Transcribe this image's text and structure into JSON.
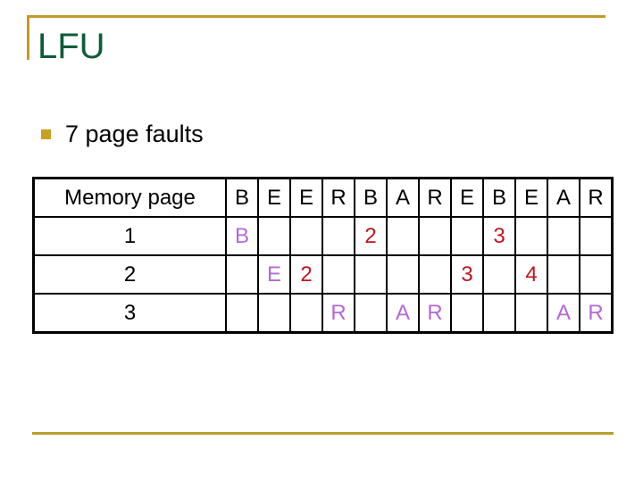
{
  "slide": {
    "title": "LFU",
    "bullets": [
      {
        "text": "7 page faults"
      }
    ]
  },
  "colors": {
    "title": "#0d5c37",
    "accent_rule": "#c09a2b",
    "bullet": "#c9a020",
    "inserted_page": "#b469d6",
    "count": "#c0141e"
  },
  "table": {
    "header_label": "Memory page",
    "reference_string": [
      "B",
      "E",
      "E",
      "R",
      "B",
      "A",
      "R",
      "E",
      "B",
      "E",
      "A",
      "R"
    ],
    "rows": [
      {
        "label": "1",
        "cells": [
          {
            "v": "B",
            "c": "purple"
          },
          {
            "v": "",
            "c": ""
          },
          {
            "v": "",
            "c": ""
          },
          {
            "v": "",
            "c": ""
          },
          {
            "v": "2",
            "c": "red"
          },
          {
            "v": "",
            "c": ""
          },
          {
            "v": "",
            "c": ""
          },
          {
            "v": "",
            "c": ""
          },
          {
            "v": "3",
            "c": "red"
          },
          {
            "v": "",
            "c": ""
          },
          {
            "v": "",
            "c": ""
          },
          {
            "v": "",
            "c": ""
          }
        ]
      },
      {
        "label": "2",
        "cells": [
          {
            "v": "",
            "c": ""
          },
          {
            "v": "E",
            "c": "purple"
          },
          {
            "v": "2",
            "c": "red"
          },
          {
            "v": "",
            "c": ""
          },
          {
            "v": "",
            "c": ""
          },
          {
            "v": "",
            "c": ""
          },
          {
            "v": "",
            "c": ""
          },
          {
            "v": "3",
            "c": "red"
          },
          {
            "v": "",
            "c": ""
          },
          {
            "v": "4",
            "c": "red"
          },
          {
            "v": "",
            "c": ""
          },
          {
            "v": "",
            "c": ""
          }
        ]
      },
      {
        "label": "3",
        "cells": [
          {
            "v": "",
            "c": ""
          },
          {
            "v": "",
            "c": ""
          },
          {
            "v": "",
            "c": ""
          },
          {
            "v": "R",
            "c": "purple"
          },
          {
            "v": "",
            "c": ""
          },
          {
            "v": "A",
            "c": "purple"
          },
          {
            "v": "R",
            "c": "purple"
          },
          {
            "v": "",
            "c": ""
          },
          {
            "v": "",
            "c": ""
          },
          {
            "v": "",
            "c": ""
          },
          {
            "v": "A",
            "c": "purple"
          },
          {
            "v": "R",
            "c": "purple"
          }
        ]
      }
    ]
  }
}
